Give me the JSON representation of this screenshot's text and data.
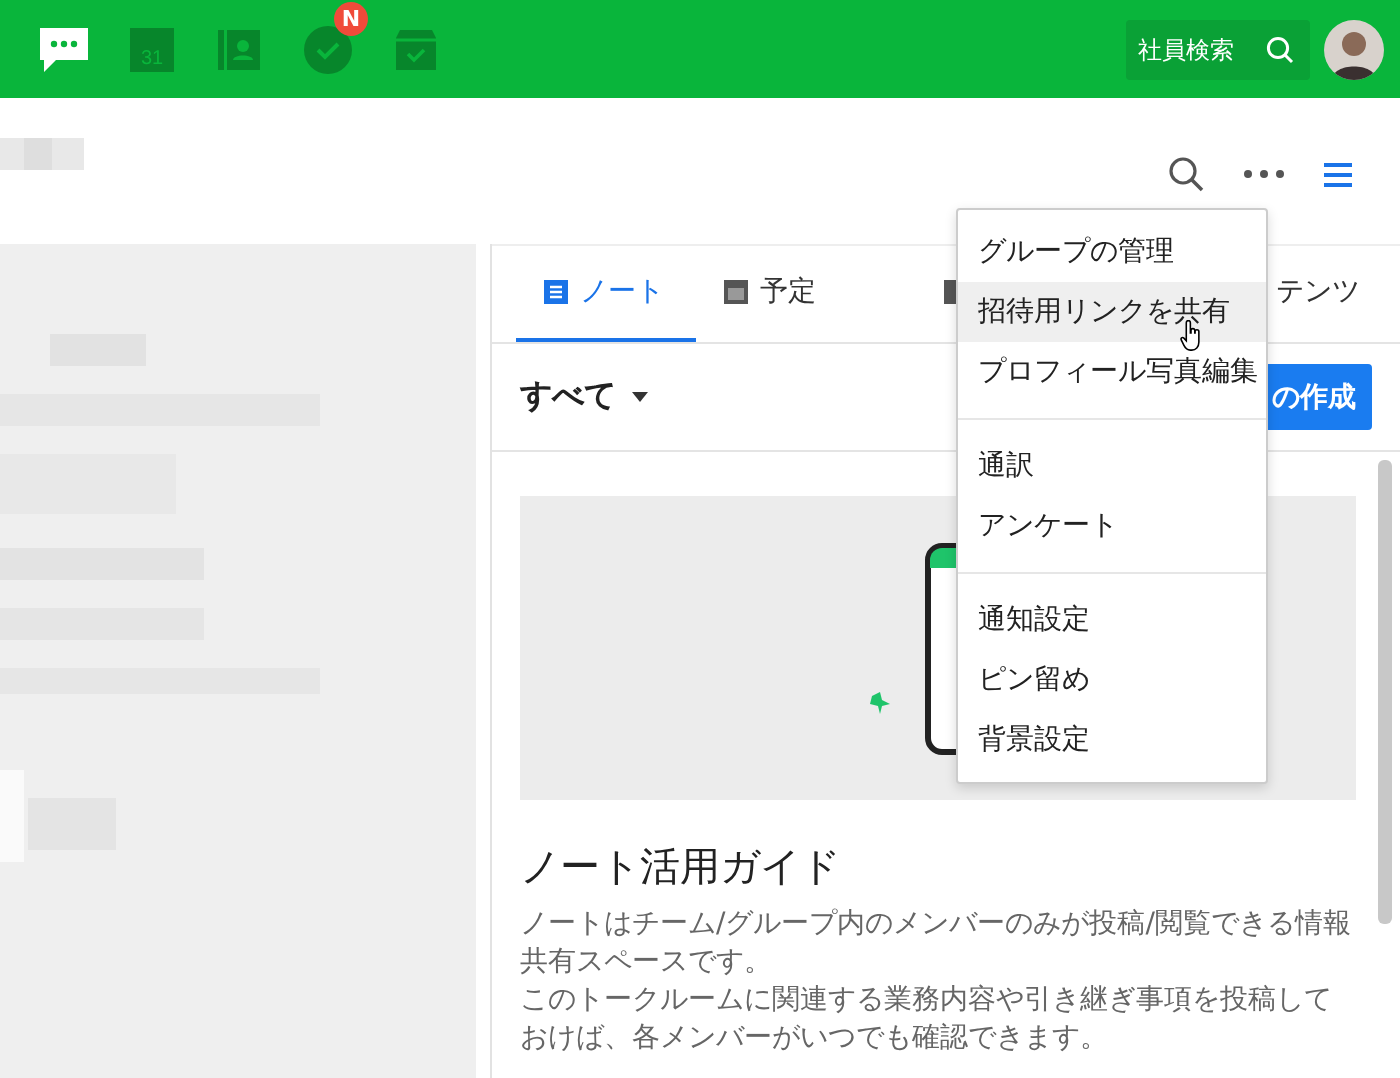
{
  "top_bar": {
    "nav": [
      {
        "kind": "chat",
        "selected": true
      },
      {
        "kind": "calendar",
        "glyph": "31",
        "selected": false
      },
      {
        "kind": "contacts",
        "selected": false
      },
      {
        "kind": "tasks",
        "badge": "N",
        "selected": false
      },
      {
        "kind": "inbox",
        "selected": false
      }
    ],
    "search": {
      "placeholder": "社員検索"
    }
  },
  "tabs": [
    {
      "label": "ノート",
      "kind": "note",
      "selected": true
    },
    {
      "label": "予定",
      "kind": "calendar",
      "selected": false
    },
    {
      "label": "テンツ",
      "kind": "folder",
      "selected": false
    }
  ],
  "filter": {
    "label": "すべて"
  },
  "create_button": {
    "label": "の作成"
  },
  "guide": {
    "title": "ノート活用ガイド",
    "paragraphs": [
      "ノートはチーム/グループ内のメンバーのみが投稿/閲覧できる情報共有スペースです。",
      "このトークルームに関連する業務内容や引き継ぎ事項を投稿しておけば、各メンバーがいつでも確認できます。"
    ]
  },
  "menu": {
    "groups": [
      {
        "items": [
          {
            "label": "グループの管理",
            "highlighted": false
          },
          {
            "label": "招待用リンクを共有",
            "highlighted": true
          },
          {
            "label": "プロフィール写真編集",
            "highlighted": false
          }
        ]
      },
      {
        "items": [
          {
            "label": "通訳",
            "highlighted": false
          },
          {
            "label": "アンケート",
            "highlighted": false
          }
        ]
      },
      {
        "items": [
          {
            "label": "通知設定",
            "highlighted": false
          },
          {
            "label": "ピン留め",
            "highlighted": false
          },
          {
            "label": "背景設定",
            "highlighted": false
          }
        ]
      }
    ]
  }
}
